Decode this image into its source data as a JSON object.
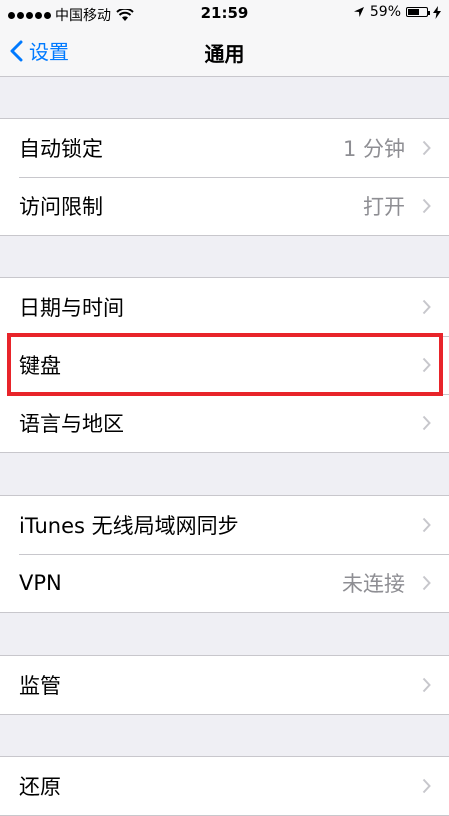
{
  "status_bar": {
    "carrier": "中国移动",
    "time": "21:59",
    "battery_percent": "59%",
    "battery_level": 0.59
  },
  "nav": {
    "back_label": "设置",
    "title": "通用"
  },
  "groups": [
    {
      "items": [
        {
          "label": "自动锁定",
          "value": "1 分钟"
        },
        {
          "label": "访问限制",
          "value": "打开"
        }
      ]
    },
    {
      "items": [
        {
          "label": "日期与时间",
          "value": ""
        },
        {
          "label": "键盘",
          "value": ""
        },
        {
          "label": "语言与地区",
          "value": ""
        }
      ]
    },
    {
      "items": [
        {
          "label": "iTunes 无线局域网同步",
          "value": ""
        },
        {
          "label": "VPN",
          "value": "未连接"
        }
      ]
    },
    {
      "items": [
        {
          "label": "监管",
          "value": ""
        }
      ]
    },
    {
      "items": [
        {
          "label": "还原",
          "value": ""
        }
      ]
    }
  ],
  "colors": {
    "accent": "#007aff",
    "highlight": "#e8242a"
  }
}
